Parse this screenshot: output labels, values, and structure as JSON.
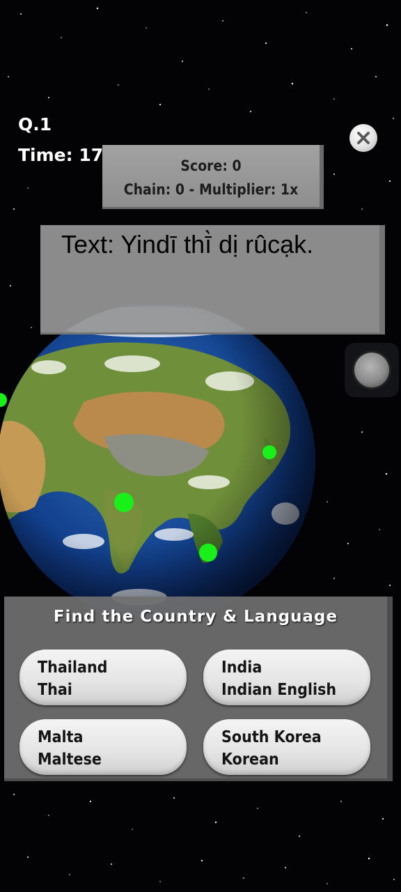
{
  "hud": {
    "question": "Q.1",
    "time_label": "Time:",
    "time_value": "17"
  },
  "score_panel": {
    "score": "Score: 0",
    "chain": "Chain: 0 - Multiplier: 1x"
  },
  "question_text": "Text: Yindī thī̀ dị rûcạk.",
  "answers_title": "Find the Country & Language",
  "answers": [
    {
      "country": "Thailand",
      "language": "Thai"
    },
    {
      "country": "India",
      "language": "Indian English"
    },
    {
      "country": "Malta",
      "language": "Maltese"
    },
    {
      "country": "South Korea",
      "language": "Korean"
    }
  ],
  "globe": {
    "marker_color": "#19f019",
    "markers": [
      "Europe west edge",
      "Japan",
      "India",
      "Thailand"
    ]
  },
  "icons": {
    "close": "close-icon",
    "hint": "hint-knob-icon"
  },
  "colors": {
    "background": "#030305",
    "panel_gray": "#9a9a9a",
    "button_white": "#eeeeee",
    "marker_green": "#19f019"
  }
}
